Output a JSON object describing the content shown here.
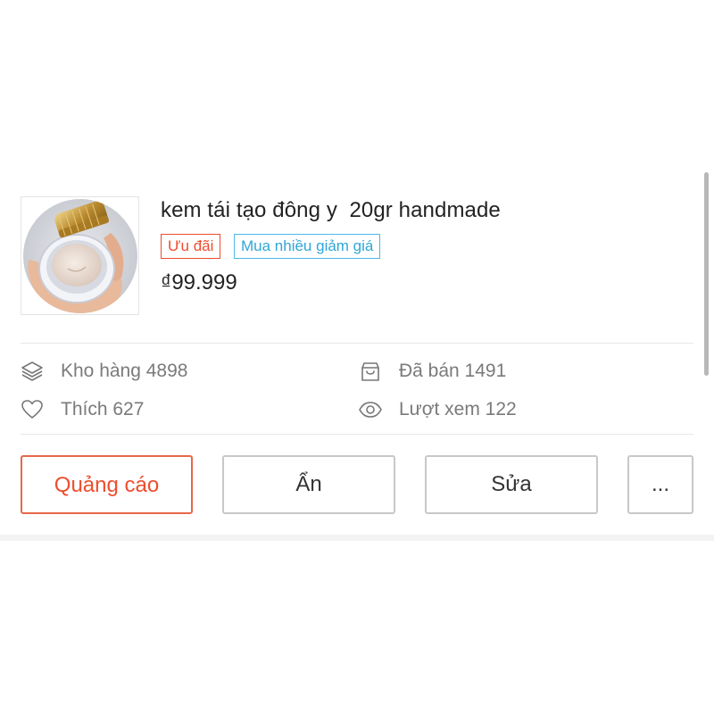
{
  "product": {
    "name": "kem tái tạo đông y  20gr handmade",
    "image_alt": "product photo: cream jar in hand",
    "tags": [
      "Ưu đãi",
      "Mua nhiều giảm giá"
    ],
    "price": "₫99.999"
  },
  "stats": {
    "stock": "Kho hàng 4898",
    "sold": "Đã bán 1491",
    "likes": "Thích 627",
    "views": "Lượt xem 122"
  },
  "actions": {
    "ads": "Quảng cáo",
    "hide": "Ẩn",
    "edit": "Sửa",
    "more": "..."
  },
  "colors": {
    "accent": "#ee4d2d",
    "tag_blue": "#2fa6d8",
    "muted_text": "#7a7a7a",
    "border": "#c8c8c8"
  },
  "icons": {
    "stock": "layers-icon",
    "sold": "shopping-bag-icon",
    "likes": "heart-icon",
    "views": "eye-icon"
  }
}
